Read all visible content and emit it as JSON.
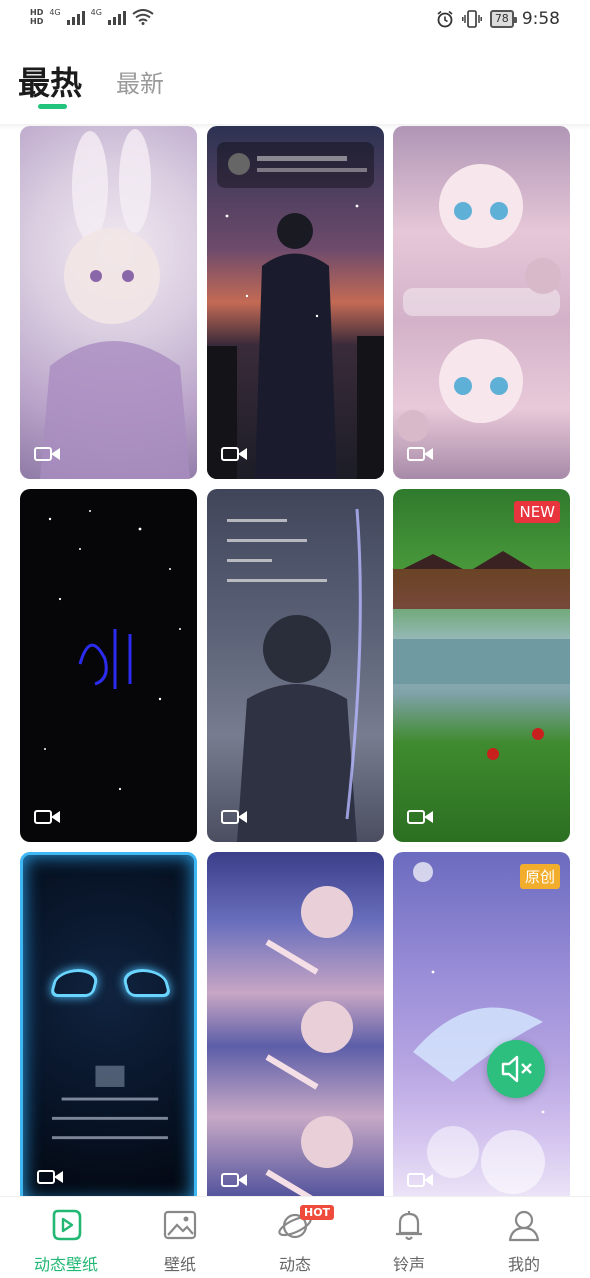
{
  "status_bar": {
    "time": "9:58",
    "battery": "78",
    "network_left": "HD",
    "network_left2": "HD",
    "signal1": "4G",
    "signal2": "4G"
  },
  "tabs": {
    "active": "最热",
    "inactive": "最新"
  },
  "accent_color": "#22c37b",
  "cards": [
    {
      "type": "video",
      "badge": ""
    },
    {
      "type": "video",
      "badge": ""
    },
    {
      "type": "video",
      "badge": ""
    },
    {
      "type": "video",
      "badge": ""
    },
    {
      "type": "video",
      "badge": ""
    },
    {
      "type": "video",
      "badge": "NEW"
    },
    {
      "type": "video",
      "badge": ""
    },
    {
      "type": "video",
      "badge": ""
    },
    {
      "type": "video",
      "badge": "原创"
    }
  ],
  "bottom_nav": [
    {
      "label": "动态壁纸",
      "icon": "play-square-icon",
      "active": true
    },
    {
      "label": "壁纸",
      "icon": "image-icon",
      "active": false
    },
    {
      "label": "动态",
      "icon": "planet-icon",
      "active": false,
      "badge": "HOT"
    },
    {
      "label": "铃声",
      "icon": "bell-icon",
      "active": false
    },
    {
      "label": "我的",
      "icon": "user-icon",
      "active": false
    }
  ]
}
